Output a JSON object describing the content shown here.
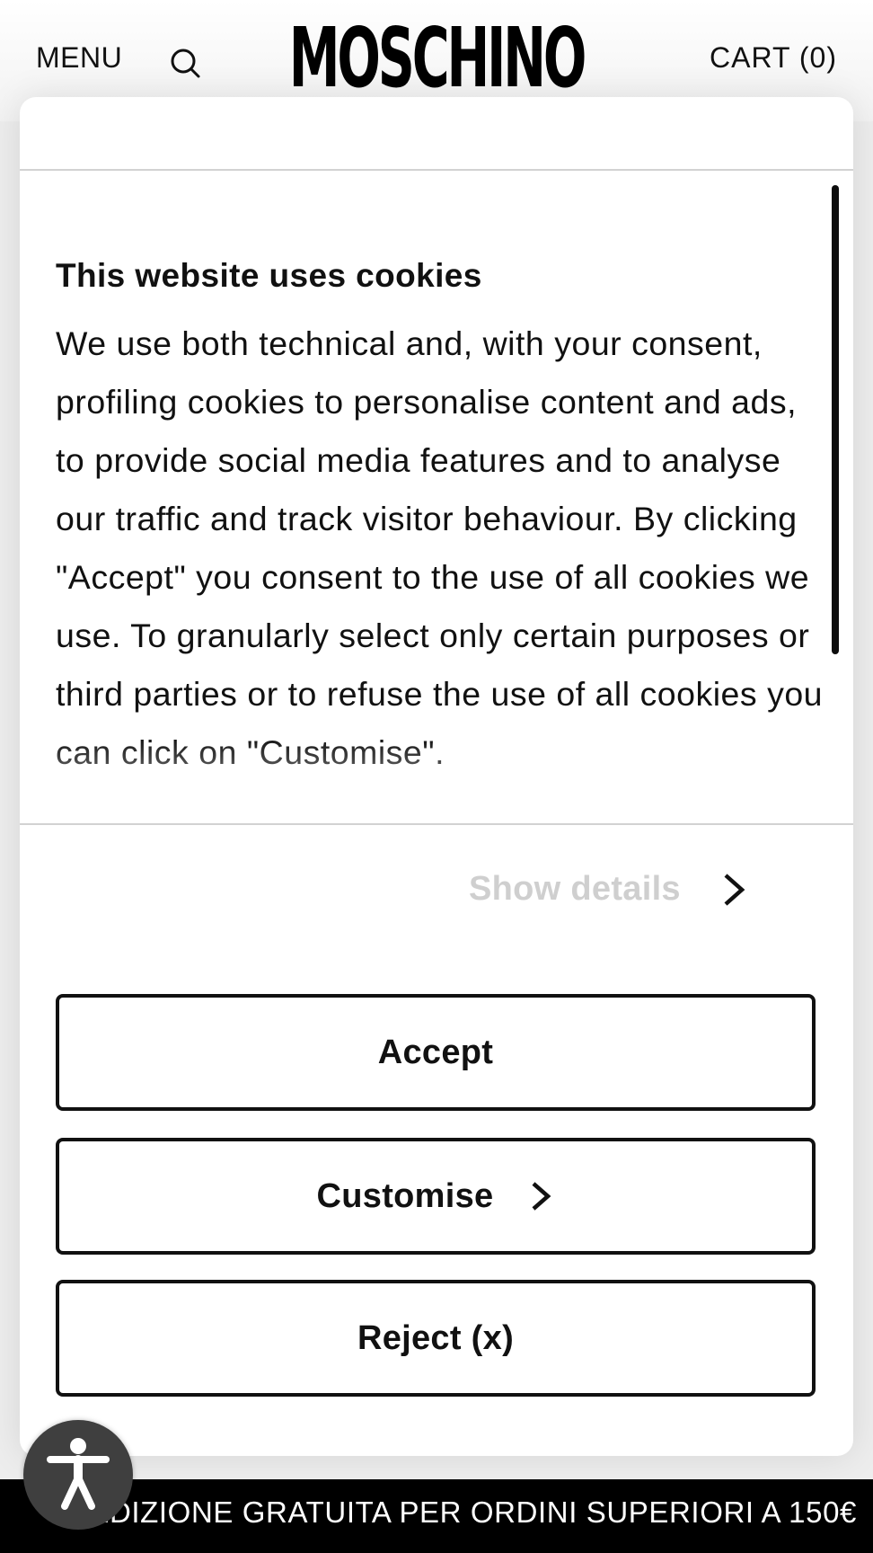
{
  "header": {
    "menu_label": "MENU",
    "search_icon": "search-icon",
    "logo_text": "MOSCHINO",
    "cart_label": "CART (0)"
  },
  "cookie_banner": {
    "title": "This website uses cookies",
    "body": "We use both technical and, with your consent, profiling cookies to personalise content and ads, to provide social media features and to analyse our traffic and track visitor behaviour. By clicking \"Accept\" you consent to the use of all cookies we use. To granularly select only certain purposes or third parties or to refuse the use of all cookies you can click on \"Customise\".",
    "show_details_label": "Show details",
    "show_details_icon": "chevron-right-icon",
    "buttons": {
      "accept": "Accept",
      "customise": "Customise",
      "reject": "Reject (x)"
    }
  },
  "promo_bar": {
    "text": "SPEDIZIONE GRATUITA PER ORDINI SUPERIORI A 150€"
  },
  "accessibility": {
    "icon": "accessibility-icon"
  },
  "colors": {
    "text": "#111111",
    "muted": "#cfcfcf",
    "promo_bg": "#000000",
    "accessibility_bg": "#3f3f3f"
  }
}
